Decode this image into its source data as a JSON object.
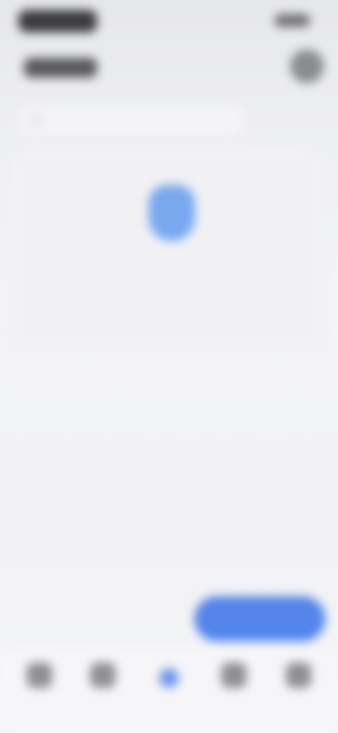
{
  "status_bar": {
    "time": "",
    "indicators": ""
  },
  "header": {
    "title": ""
  },
  "search": {
    "placeholder": ""
  },
  "card": {
    "title": "",
    "subtitle": ""
  },
  "fab": {
    "label": ""
  },
  "tabs": [
    {
      "label": "",
      "icon": "home-icon"
    },
    {
      "label": "",
      "icon": "grid-icon"
    },
    {
      "label": "",
      "icon": "shield-icon"
    },
    {
      "label": "",
      "icon": "box-icon"
    },
    {
      "label": "",
      "icon": "person-icon"
    }
  ],
  "colors": {
    "accent": "#5384ea",
    "shield": "#79a8ef"
  }
}
